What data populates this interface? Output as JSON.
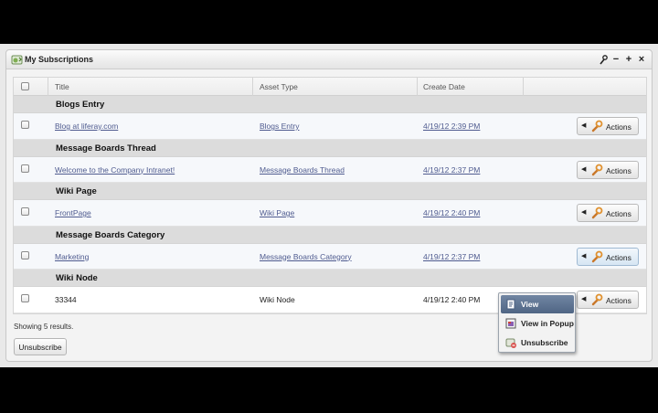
{
  "portlet": {
    "title": "My Subscriptions",
    "controls": [
      "wrench-icon",
      "minimize-icon",
      "maximize-icon",
      "close-icon"
    ]
  },
  "table": {
    "headers": {
      "title": "Title",
      "asset_type": "Asset Type",
      "create_date": "Create Date"
    },
    "groups": [
      {
        "heading": "Blogs Entry",
        "row": {
          "title": "Blog at liferay.com",
          "asset_type": "Blogs Entry",
          "date": "4/19/12 2:39 PM",
          "linked": true,
          "action": "Actions"
        }
      },
      {
        "heading": "Message Boards Thread",
        "row": {
          "title": "Welcome to the Company Intranet!",
          "asset_type": "Message Boards Thread",
          "date": "4/19/12 2:37 PM",
          "linked": true,
          "action": "Actions"
        }
      },
      {
        "heading": "Wiki Page",
        "row": {
          "title": "FrontPage",
          "asset_type": "Wiki Page",
          "date": "4/19/12 2:40 PM",
          "linked": true,
          "action": "Actions"
        }
      },
      {
        "heading": "Message Boards Category",
        "row": {
          "title": "Marketing",
          "asset_type": "Message Boards Category",
          "date": "4/19/12 2:37 PM",
          "linked": true,
          "action": "Actions"
        }
      },
      {
        "heading": "Wiki Node",
        "row": {
          "title": "33344",
          "asset_type": "Wiki Node",
          "date": "4/19/12 2:40 PM",
          "linked": false,
          "action": "Actions"
        }
      }
    ]
  },
  "footer": {
    "results": "Showing 5 results.",
    "unsubscribe_button": "Unsubscribe"
  },
  "actions_menu": {
    "items": [
      {
        "label": "View",
        "icon": "page-icon",
        "highlighted": true
      },
      {
        "label": "View in Popup",
        "icon": "popup-icon",
        "highlighted": false
      },
      {
        "label": "Unsubscribe",
        "icon": "unsubscribe-icon",
        "highlighted": false
      }
    ]
  },
  "colors": {
    "link": "#4f5b8f",
    "menu_highlight": "#5e7393",
    "group_band": "#dcdcdc"
  }
}
